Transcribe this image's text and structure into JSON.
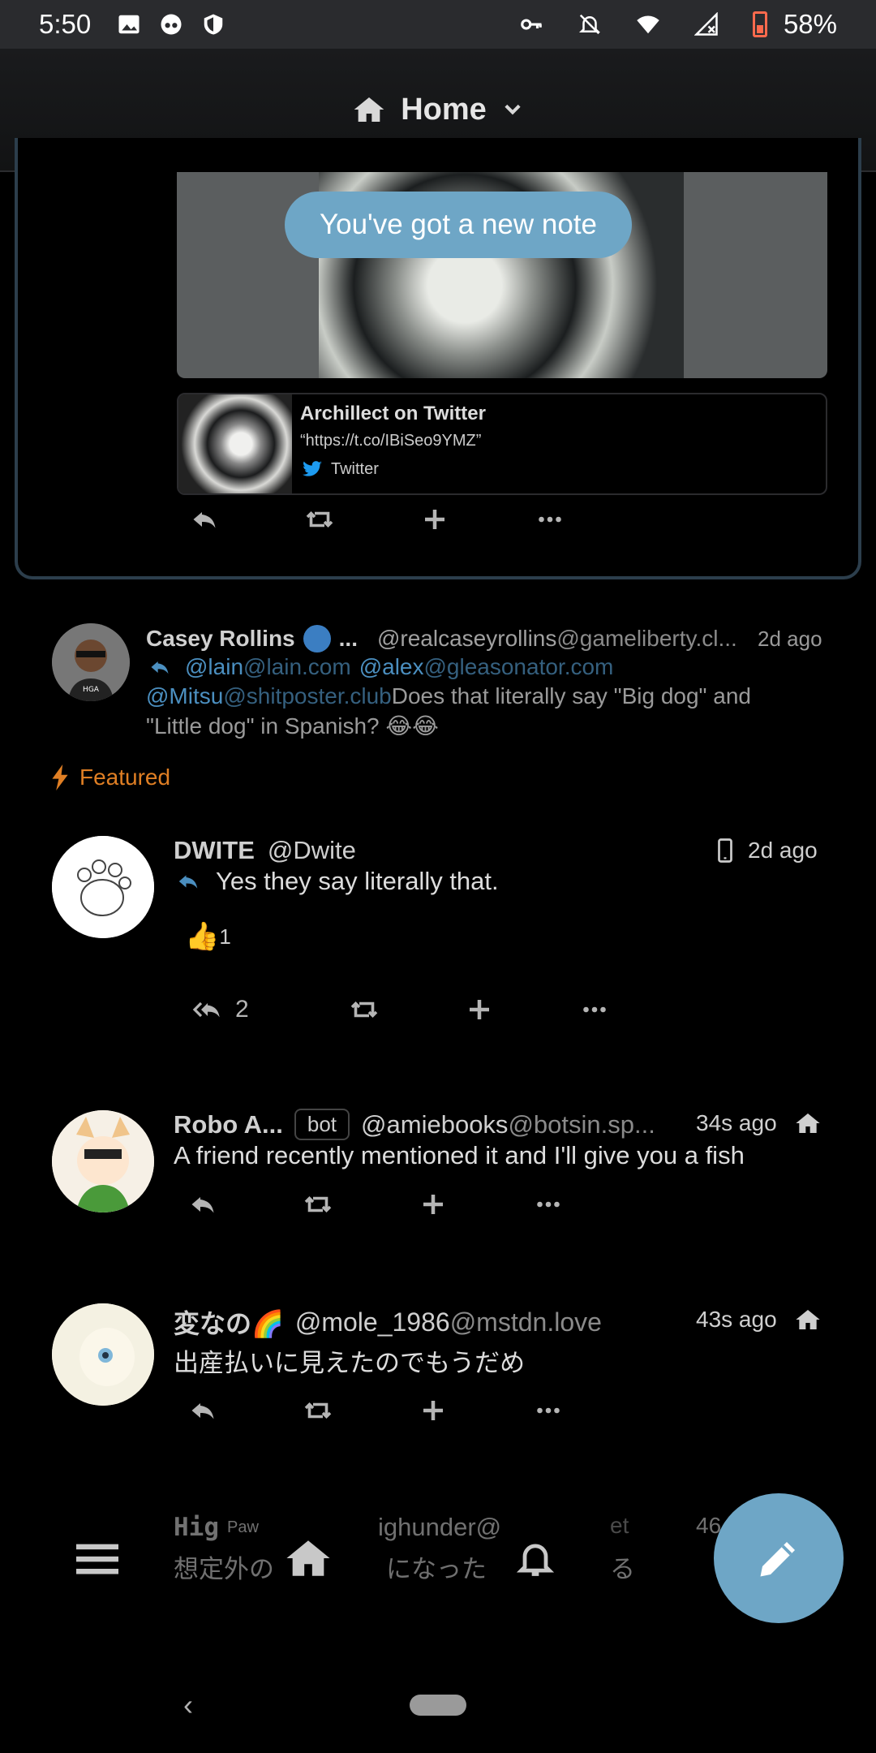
{
  "statusbar": {
    "time": "5:50",
    "battery": "58%"
  },
  "header": {
    "title": "Home"
  },
  "top_card": {
    "toast": "You've got a new note",
    "link": {
      "title": "Archillect on Twitter",
      "desc": "“https://t.co/IBiSeo9YMZ”",
      "source": "Twitter"
    }
  },
  "posts": [
    {
      "name": "Casey Rollins",
      "name_suffix": "...",
      "handle": "@realcaseyrollins",
      "domain": "@gameliberty.cl...",
      "time": "2d ago",
      "mentions": [
        {
          "user": "@lain",
          "domain": "@lain.com"
        },
        {
          "user": "@alex",
          "domain": "@gleasonator.com"
        },
        {
          "user": "@Mitsu",
          "domain": "@shitposter.club"
        }
      ],
      "text1": " Does that literally say \"Big dog\" and",
      "text2": "\"Little dog\" in Spanish? 😂😂"
    },
    {
      "featured_label": "Featured",
      "name": "DWITE",
      "handle": "@Dwite",
      "time": "2d ago",
      "text": "Yes they say literally that.",
      "reaction_emoji": "👍",
      "reaction_count": "1",
      "reply_count": "2"
    },
    {
      "name": "Robo A...",
      "bot_label": "bot",
      "handle": "@amiebooks",
      "domain": "@botsin.sp...",
      "time": "34s ago",
      "text": "A friend recently mentioned it and I'll give you a fish"
    },
    {
      "name": "変なの🌈",
      "handle": "@mole_1986",
      "domain": "@mstdn.love",
      "time": "43s ago",
      "text": "出産払いに見えたのでもうだめ"
    },
    {
      "name_partial": "Hig",
      "name_sup": "Paw",
      "handle_partial": "ighunder@",
      "domain_partial": "et",
      "time_partial": "46",
      "text_partial1": "想定外の",
      "text_partial2": "になった",
      "text_partial3": "る"
    }
  ],
  "colors": {
    "accent": "#6ea6c6",
    "featured": "#e07f24",
    "mention": "#4b8fc0"
  }
}
